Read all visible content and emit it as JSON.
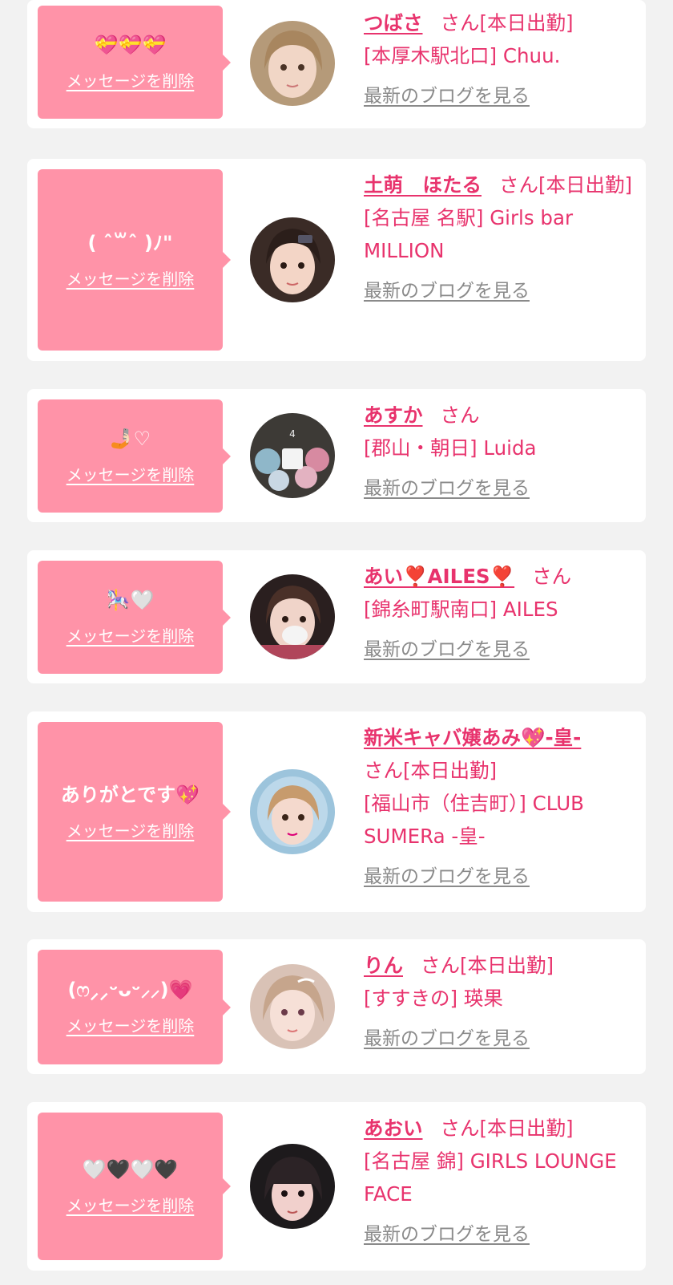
{
  "delete_label": "メッセージを削除",
  "blog_label": "最新のブログを見る",
  "honorific": "さん",
  "colors": {
    "bubble": "#ff93a8",
    "accent": "#e8336d",
    "link_gray": "#8a8a8a",
    "page_bg": "#f2f2f2",
    "card_bg": "#ffffff"
  },
  "items": [
    {
      "message": "💝💝💝",
      "name": "つばさ",
      "status": "[本日出勤]",
      "shop": "[本厚木駅北口] Chuu."
    },
    {
      "message": "( ˆ꒳ˆ )ﾉ\"",
      "name": "土萌　ほたる",
      "status": "[本日出勤]",
      "shop": "[名古屋 名駅] Girls bar MILLION"
    },
    {
      "message": "🤳🏻♡",
      "name": "あすか",
      "status": "",
      "shop": "[郡山・朝日] Luida"
    },
    {
      "message": "🎠🤍",
      "name": "あい❣️AILES❣️",
      "status": "",
      "shop": "[錦糸町駅南口] AILES"
    },
    {
      "message": "ありがとです💖",
      "name": "新米キャバ嬢あみ💖-皇-",
      "status": "[本日出勤]",
      "shop": "[福山市（住吉町）] CLUB SUMERa -皇-"
    },
    {
      "message": "(ෆ⸝⸝ᵕᴗᵕ⸝⸝)💗",
      "name": "りん",
      "status": "[本日出勤]",
      "shop": "[すすきの] 瑛果"
    },
    {
      "message": "🤍🖤🤍🖤",
      "name": "あおい",
      "status": "[本日出勤]",
      "shop": "[名古屋 錦] GIRLS LOUNGE FACE"
    }
  ]
}
